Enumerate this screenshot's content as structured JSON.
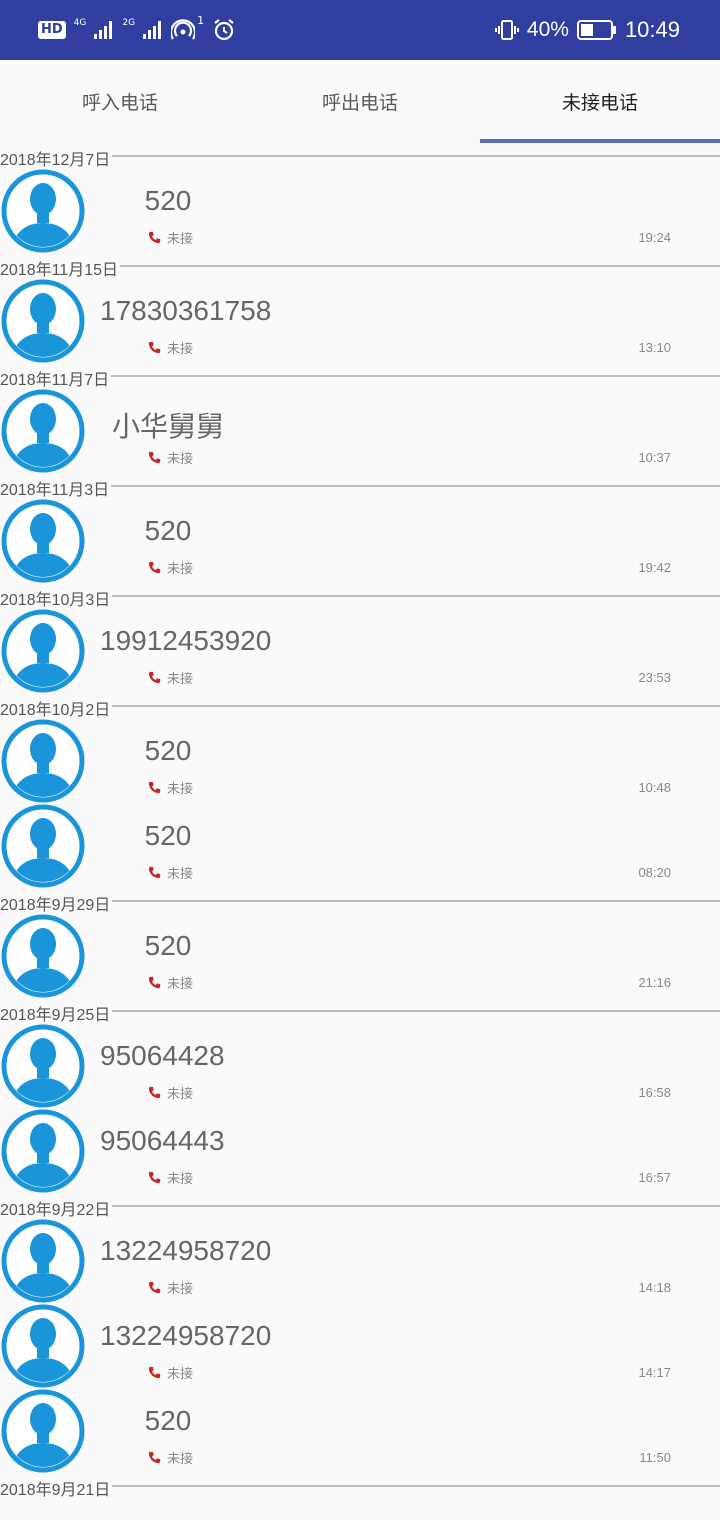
{
  "status_bar": {
    "hd": "HD",
    "net1": "4G",
    "net2": "2G",
    "hotspot_count": "1",
    "battery": "40%",
    "time": "10:49"
  },
  "tabs": [
    {
      "label": "呼入电话"
    },
    {
      "label": "呼出电话"
    },
    {
      "label": "未接电话"
    }
  ],
  "missed_label": "未接",
  "groups": [
    {
      "date": "2018年12月7日",
      "calls": [
        {
          "name": "520",
          "time": "19:24"
        }
      ]
    },
    {
      "date": "2018年11月15日",
      "calls": [
        {
          "name": "17830361758",
          "time": "13:10"
        }
      ]
    },
    {
      "date": "2018年11月7日",
      "calls": [
        {
          "name": "小华舅舅",
          "time": "10:37"
        }
      ]
    },
    {
      "date": "2018年11月3日",
      "calls": [
        {
          "name": "520",
          "time": "19:42"
        }
      ]
    },
    {
      "date": "2018年10月3日",
      "calls": [
        {
          "name": "19912453920",
          "time": "23:53"
        }
      ]
    },
    {
      "date": "2018年10月2日",
      "calls": [
        {
          "name": "520",
          "time": "10:48"
        },
        {
          "name": "520",
          "time": "08:20"
        }
      ]
    },
    {
      "date": "2018年9月29日",
      "calls": [
        {
          "name": "520",
          "time": "21:16"
        }
      ]
    },
    {
      "date": "2018年9月25日",
      "calls": [
        {
          "name": "95064428",
          "time": "16:58"
        },
        {
          "name": "95064443",
          "time": "16:57"
        }
      ]
    },
    {
      "date": "2018年9月22日",
      "calls": [
        {
          "name": "13224958720",
          "time": "14:18"
        },
        {
          "name": "13224958720",
          "time": "14:17"
        },
        {
          "name": "520",
          "time": "11:50"
        }
      ]
    },
    {
      "date": "2018年9月21日",
      "calls": []
    }
  ],
  "colors": {
    "status_bar": "#303f9f",
    "tab_indicator": "#5c6bc0",
    "avatar": "#1b95d9",
    "missed_icon": "#c62828"
  }
}
